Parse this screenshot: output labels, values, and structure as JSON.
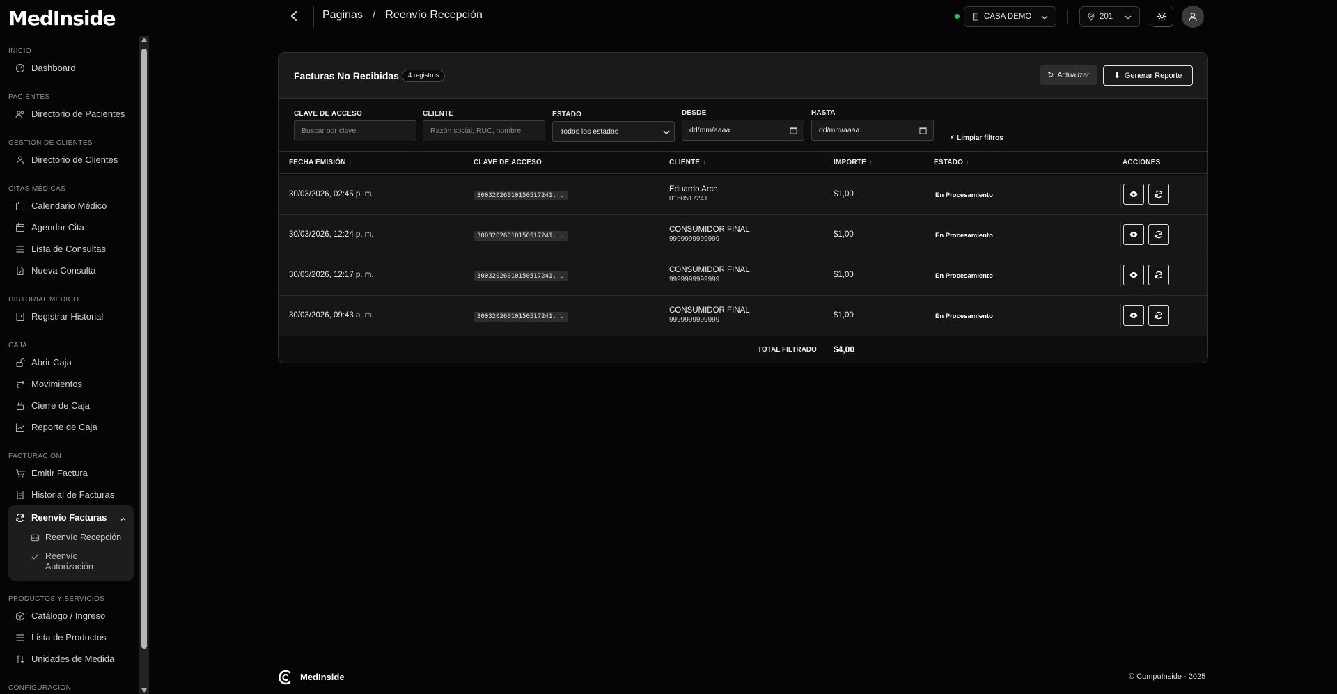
{
  "brand": "MedInside",
  "sidebar": {
    "sections": [
      {
        "title": "INICIO",
        "items": [
          {
            "label": "Dashboard",
            "icon": "gauge-icon"
          }
        ]
      },
      {
        "title": "PACIENTES",
        "items": [
          {
            "label": "Directorio de Pacientes",
            "icon": "users-icon"
          }
        ]
      },
      {
        "title": "GESTIÓN DE CLIENTES",
        "items": [
          {
            "label": "Directorio de Clientes",
            "icon": "user-icon"
          }
        ]
      },
      {
        "title": "CITAS MÉDICAS",
        "items": [
          {
            "label": "Calendario Médico",
            "icon": "calendar-icon"
          },
          {
            "label": "Agendar Cita",
            "icon": "calendar-plus-icon"
          },
          {
            "label": "Lista de Consultas",
            "icon": "list-icon"
          },
          {
            "label": "Nueva Consulta",
            "icon": "file-edit-icon"
          }
        ]
      },
      {
        "title": "HISTORIAL MÉDICO",
        "items": [
          {
            "label": "Registrar Historial",
            "icon": "book-icon"
          }
        ]
      },
      {
        "title": "CAJA",
        "items": [
          {
            "label": "Abrir Caja",
            "icon": "unlock-icon"
          },
          {
            "label": "Movimientos",
            "icon": "arrows-icon"
          },
          {
            "label": "Cierre de Caja",
            "icon": "lock-icon"
          },
          {
            "label": "Reporte de Caja",
            "icon": "chart-line-icon"
          }
        ]
      },
      {
        "title": "FACTURACIÓN",
        "items": [
          {
            "label": "Emitir Factura",
            "icon": "cart-icon"
          },
          {
            "label": "Historial de Facturas",
            "icon": "receipt-icon"
          }
        ]
      },
      {
        "title": "PRODUCTOS Y SERVICIOS",
        "items": [
          {
            "label": "Catálogo / Ingreso",
            "icon": "box-icon"
          },
          {
            "label": "Lista de Productos",
            "icon": "list-icon"
          },
          {
            "label": "Unidades de Medida",
            "icon": "sort-icon"
          }
        ]
      },
      {
        "title": "CONFIGURACIÓN",
        "items": []
      }
    ],
    "active_group": {
      "label": "Reenvío Facturas",
      "subitems": [
        {
          "label": "Reenvío Recepción"
        },
        {
          "label": "Reenvío Autorización"
        }
      ]
    }
  },
  "header": {
    "breadcrumb_root": "Paginas",
    "breadcrumb_sep": "/",
    "breadcrumb_current": "Reenvío Recepción",
    "company": "CASA DEMO",
    "location": "201"
  },
  "card": {
    "title": "Facturas No Recibidas",
    "count_badge": "4 registros",
    "refresh_label": "Actualizar",
    "report_label": "Generar Reporte"
  },
  "filters": {
    "clave_label": "CLAVE DE ACCESO",
    "clave_placeholder": "Buscar por clave...",
    "cliente_label": "CLIENTE",
    "cliente_placeholder": "Razón social, RUC, nombre...",
    "estado_label": "ESTADO",
    "estado_value": "Todos los estados",
    "desde_label": "DESDE",
    "desde_placeholder": "dd/mm/aaaa",
    "hasta_label": "HASTA",
    "hasta_placeholder": "dd/mm/aaaa",
    "clear_label": "Limpiar filtros"
  },
  "table": {
    "columns": {
      "fecha": "FECHA EMISIÓN",
      "clave": "CLAVE DE ACCESO",
      "cliente": "CLIENTE",
      "importe": "IMPORTE",
      "estado": "ESTADO",
      "acciones": "ACCIONES"
    },
    "rows": [
      {
        "fecha": "30/03/2026, 02:45 p. m.",
        "clave": "3003202601015051724​1...",
        "cliente": "Eduardo Arce",
        "ruc": "0150517241",
        "importe": "$1,00",
        "estado": "En Procesamiento"
      },
      {
        "fecha": "30/03/2026, 12:24 p. m.",
        "clave": "3003202601015051724​1...",
        "cliente": "CONSUMIDOR FINAL",
        "ruc": "9999999999999",
        "importe": "$1,00",
        "estado": "En Procesamiento"
      },
      {
        "fecha": "30/03/2026, 12:17 p. m.",
        "clave": "3003202601015051724​1...",
        "cliente": "CONSUMIDOR FINAL",
        "ruc": "9999999999999",
        "importe": "$1,00",
        "estado": "En Procesamiento"
      },
      {
        "fecha": "30/03/2026, 09:43 a. m.",
        "clave": "3003202601015051724​1...",
        "cliente": "CONSUMIDOR FINAL",
        "ruc": "9999999999999",
        "importe": "$1,00",
        "estado": "En Procesamiento"
      }
    ],
    "total_label": "TOTAL FILTRADO",
    "total_value": "$4,00"
  },
  "footer": {
    "brand": "MedInside",
    "copyright": "© CompuInside - 2025"
  },
  "colors": {
    "background": "#050505",
    "card": "#0e0e0e",
    "status_online": "#22c55e"
  }
}
